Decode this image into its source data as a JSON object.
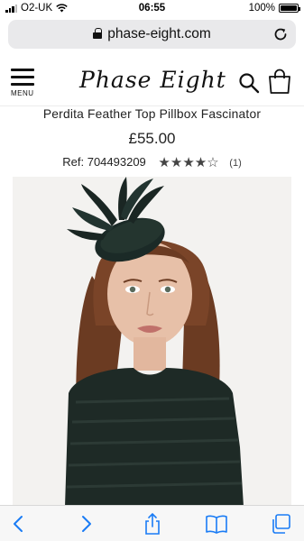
{
  "status_bar": {
    "carrier": "O2-UK",
    "time": "06:55",
    "battery": "100%"
  },
  "browser": {
    "url": "phase-eight.com"
  },
  "header": {
    "menu_label": "MENU",
    "logo": "Phase Eight"
  },
  "product": {
    "title": "Perdita Feather Top Pillbox Fascinator",
    "price": "£55.00",
    "ref_label": "Ref:",
    "ref_number": "704493209",
    "rating_stars": "★★★★☆",
    "rating_value": 4,
    "review_count": "(1)"
  },
  "icons": {
    "menu": "hamburger-icon",
    "search": "search-icon",
    "bag": "shopping-bag-icon",
    "back": "chevron-left-icon",
    "forward": "chevron-right-icon",
    "share": "share-icon",
    "bookmarks": "book-icon",
    "tabs": "tabs-icon"
  },
  "colors": {
    "toolbar_accent": "#1a7cf5",
    "text": "#222222"
  }
}
